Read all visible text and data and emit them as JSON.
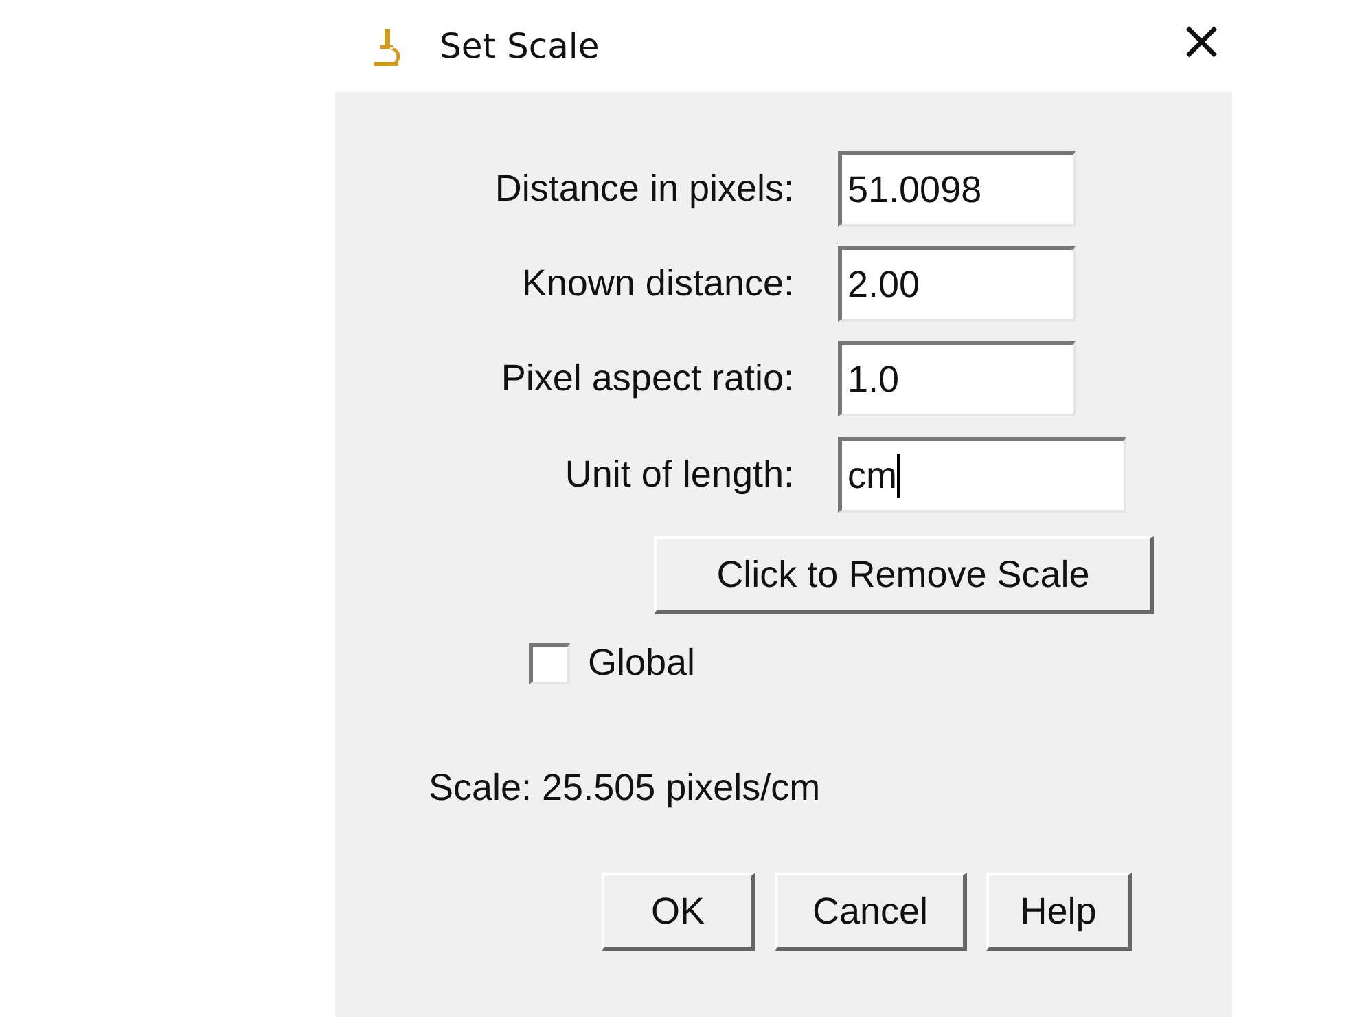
{
  "window": {
    "title": "Set Scale",
    "close": "×"
  },
  "fields": [
    {
      "label": "Distance in pixels:",
      "value": "51.0098",
      "focused": false,
      "wide": false
    },
    {
      "label": "Known distance:",
      "value": "2.00",
      "focused": false,
      "wide": false
    },
    {
      "label": "Pixel aspect ratio:",
      "value": "1.0",
      "focused": false,
      "wide": false
    },
    {
      "label": "Unit of length:",
      "value": "cm",
      "focused": true,
      "wide": true
    }
  ],
  "remove_button": "Click to Remove Scale",
  "global": {
    "label": "Global",
    "checked": false
  },
  "scale_text": "Scale: 25.505 pixels/cm",
  "buttons": [
    "OK",
    "Cancel",
    "Help"
  ]
}
